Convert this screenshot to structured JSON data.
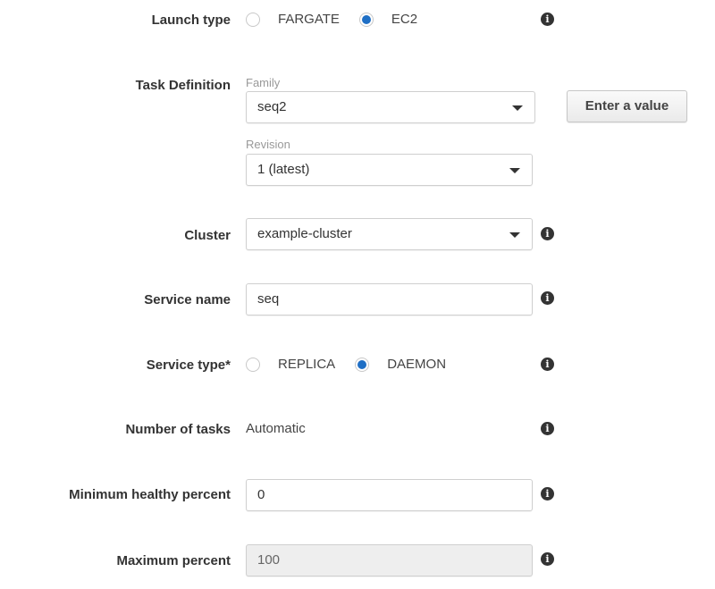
{
  "launch_type": {
    "label": "Launch type",
    "options": [
      {
        "label": "FARGATE",
        "selected": false
      },
      {
        "label": "EC2",
        "selected": true
      }
    ]
  },
  "task_definition": {
    "label": "Task Definition",
    "family_label": "Family",
    "family_value": "seq2",
    "revision_label": "Revision",
    "revision_value": "1 (latest)",
    "enter_value_button": "Enter a value"
  },
  "cluster": {
    "label": "Cluster",
    "value": "example-cluster"
  },
  "service_name": {
    "label": "Service name",
    "value": "seq"
  },
  "service_type": {
    "label": "Service type*",
    "options": [
      {
        "label": "REPLICA",
        "selected": false
      },
      {
        "label": "DAEMON",
        "selected": true
      }
    ]
  },
  "number_of_tasks": {
    "label": "Number of tasks",
    "value": "Automatic"
  },
  "minimum_healthy_percent": {
    "label": "Minimum healthy percent",
    "value": "0"
  },
  "maximum_percent": {
    "label": "Maximum percent",
    "value": "100",
    "disabled": true
  },
  "icons": {
    "info": "info-icon",
    "dropdown": "caret-down-icon"
  },
  "colors": {
    "radio_selected": "#1f6fc5",
    "info_icon": "#333333",
    "disabled_field": "#eeeeee"
  }
}
